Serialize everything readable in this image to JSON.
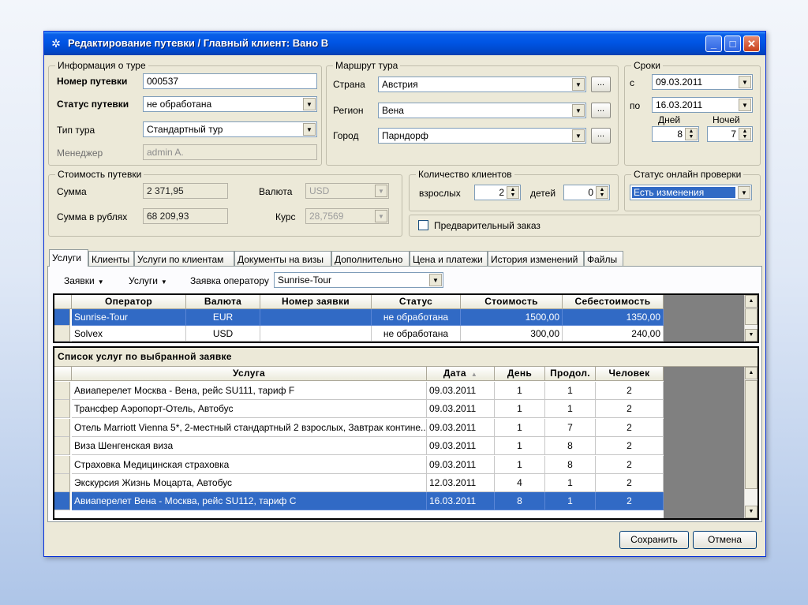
{
  "window": {
    "title": "Редактирование путевки / Главный клиент: Вано В",
    "min": "_",
    "max": "□",
    "close": "✕"
  },
  "tour_info": {
    "legend": "Информация о туре",
    "number_label": "Номер путевки",
    "number": "000537",
    "status_label": "Статус путевки",
    "status": "не обработана",
    "type_label": "Тип тура",
    "type": "Стандартный тур",
    "manager_label": "Менеджер",
    "manager": "admin A."
  },
  "route": {
    "legend": "Маршрут тура",
    "country_label": "Страна",
    "country": "Австрия",
    "region_label": "Регион",
    "region": "Вена",
    "city_label": "Город",
    "city": "Парндорф",
    "more": "..."
  },
  "dates": {
    "legend": "Сроки",
    "from_label": "с",
    "from": "09.03.2011",
    "to_label": "по",
    "to": "16.03.2011",
    "days_label": "Дней",
    "days": "8",
    "nights_label": "Ночей",
    "nights": "7"
  },
  "cost": {
    "legend": "Стоимость путевки",
    "sum_label": "Сумма",
    "sum": "2 371,95",
    "currency_label": "Валюта",
    "currency": "USD",
    "rub_label": "Сумма в рублях",
    "rub": "68 209,93",
    "rate_label": "Курс",
    "rate": "28,7569"
  },
  "clients": {
    "legend": "Количество клиентов",
    "adults_label": "взрослых",
    "adults": "2",
    "kids_label": "детей",
    "kids": "0"
  },
  "online": {
    "legend": "Статус онлайн проверки",
    "value": "Есть изменения"
  },
  "prelim": {
    "label": "Предварительный заказ"
  },
  "tabs": [
    "Услуги",
    "Клиенты",
    "Услуги по клиентам",
    "Документы на визы",
    "Дополнительно",
    "Цена и платежи",
    "История изменений",
    "Файлы"
  ],
  "toolbar": {
    "orders": "Заявки",
    "services": "Услуги",
    "op_label": "Заявка оператору",
    "op_value": "Sunrise-Tour"
  },
  "orders": {
    "headers": [
      "Оператор",
      "Валюта",
      "Номер заявки",
      "Статус",
      "Стоимость",
      "Себестоимость"
    ],
    "rows": [
      [
        "Sunrise-Tour",
        "EUR",
        "",
        "не обработана",
        "1500,00",
        "1350,00"
      ],
      [
        "Solvex",
        "USD",
        "",
        "не обработана",
        "300,00",
        "240,00"
      ]
    ]
  },
  "services": {
    "title": "Список услуг по выбранной заявке",
    "headers": [
      "Услуга",
      "Дата",
      "День",
      "Продол.",
      "Человек"
    ],
    "rows": [
      [
        "Авиаперелет Москва - Вена, рейс SU111, тариф F",
        "09.03.2011",
        "1",
        "1",
        "2"
      ],
      [
        "Трансфер Аэропорт-Отель, Автобус",
        "09.03.2011",
        "1",
        "1",
        "2"
      ],
      [
        "Отель Marriott Vienna 5*, 2-местный стандартный 2 взрослых, Завтрак контине...",
        "09.03.2011",
        "1",
        "7",
        "2"
      ],
      [
        "Виза Шенгенская виза",
        "09.03.2011",
        "1",
        "8",
        "2"
      ],
      [
        "Страховка Медицинская страховка",
        "09.03.2011",
        "1",
        "8",
        "2"
      ],
      [
        "Экскурсия Жизнь Моцарта, Автобус",
        "12.03.2011",
        "4",
        "1",
        "2"
      ],
      [
        "Авиаперелет Вена - Москва, рейс SU112, тариф C",
        "16.03.2011",
        "8",
        "1",
        "2"
      ]
    ]
  },
  "buttons": {
    "save": "Сохранить",
    "cancel": "Отмена"
  }
}
